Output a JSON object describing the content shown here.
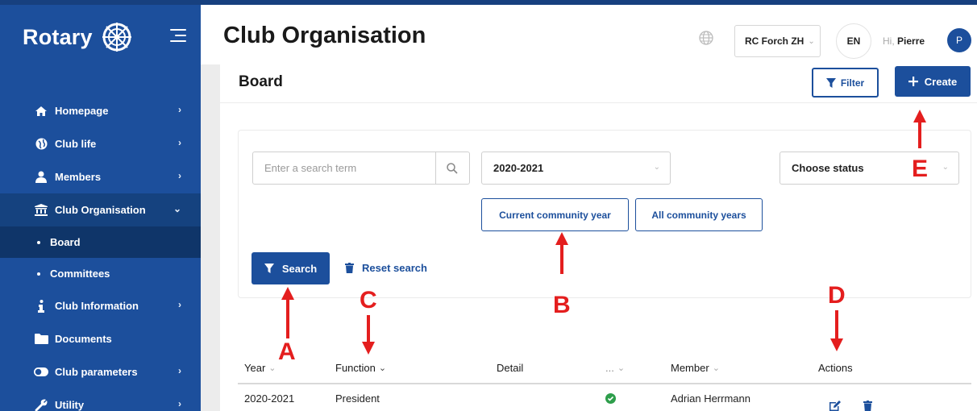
{
  "sidebar": {
    "logo_text": "Rotary",
    "items": [
      {
        "label": "Homepage"
      },
      {
        "label": "Club life"
      },
      {
        "label": "Members"
      },
      {
        "label": "Club Organisation"
      },
      {
        "label": "Board"
      },
      {
        "label": "Committees"
      },
      {
        "label": "Club Information"
      },
      {
        "label": "Documents"
      },
      {
        "label": "Club parameters"
      },
      {
        "label": "Utility"
      }
    ]
  },
  "header": {
    "title": "Club Organisation",
    "club": "RC Forch ZH",
    "language": "EN",
    "greeting": "Hi,",
    "user_name": "Pierre",
    "avatar_initial": "P"
  },
  "board": {
    "title": "Board",
    "filter_label": "Filter",
    "create_label": "Create"
  },
  "search": {
    "placeholder": "Enter a search term",
    "year_value": "2020-2021",
    "status_placeholder": "Choose status",
    "current_year_label": "Current community year",
    "all_years_label": "All community years",
    "search_label": "Search",
    "reset_label": "Reset search"
  },
  "table": {
    "columns": [
      "Year",
      "Function",
      "Detail",
      "...",
      "Member",
      "Actions"
    ],
    "rows": [
      {
        "year": "2020-2021",
        "function": "President",
        "detail": "",
        "status": "ok",
        "member": "Adrian Herrmann"
      }
    ]
  },
  "annotations": {
    "a": "A",
    "b": "B",
    "c": "C",
    "d": "D",
    "e": "E"
  },
  "colors": {
    "primary": "#1c4f9c",
    "annotation": "#e41e1e",
    "success": "#2e9e4b"
  }
}
